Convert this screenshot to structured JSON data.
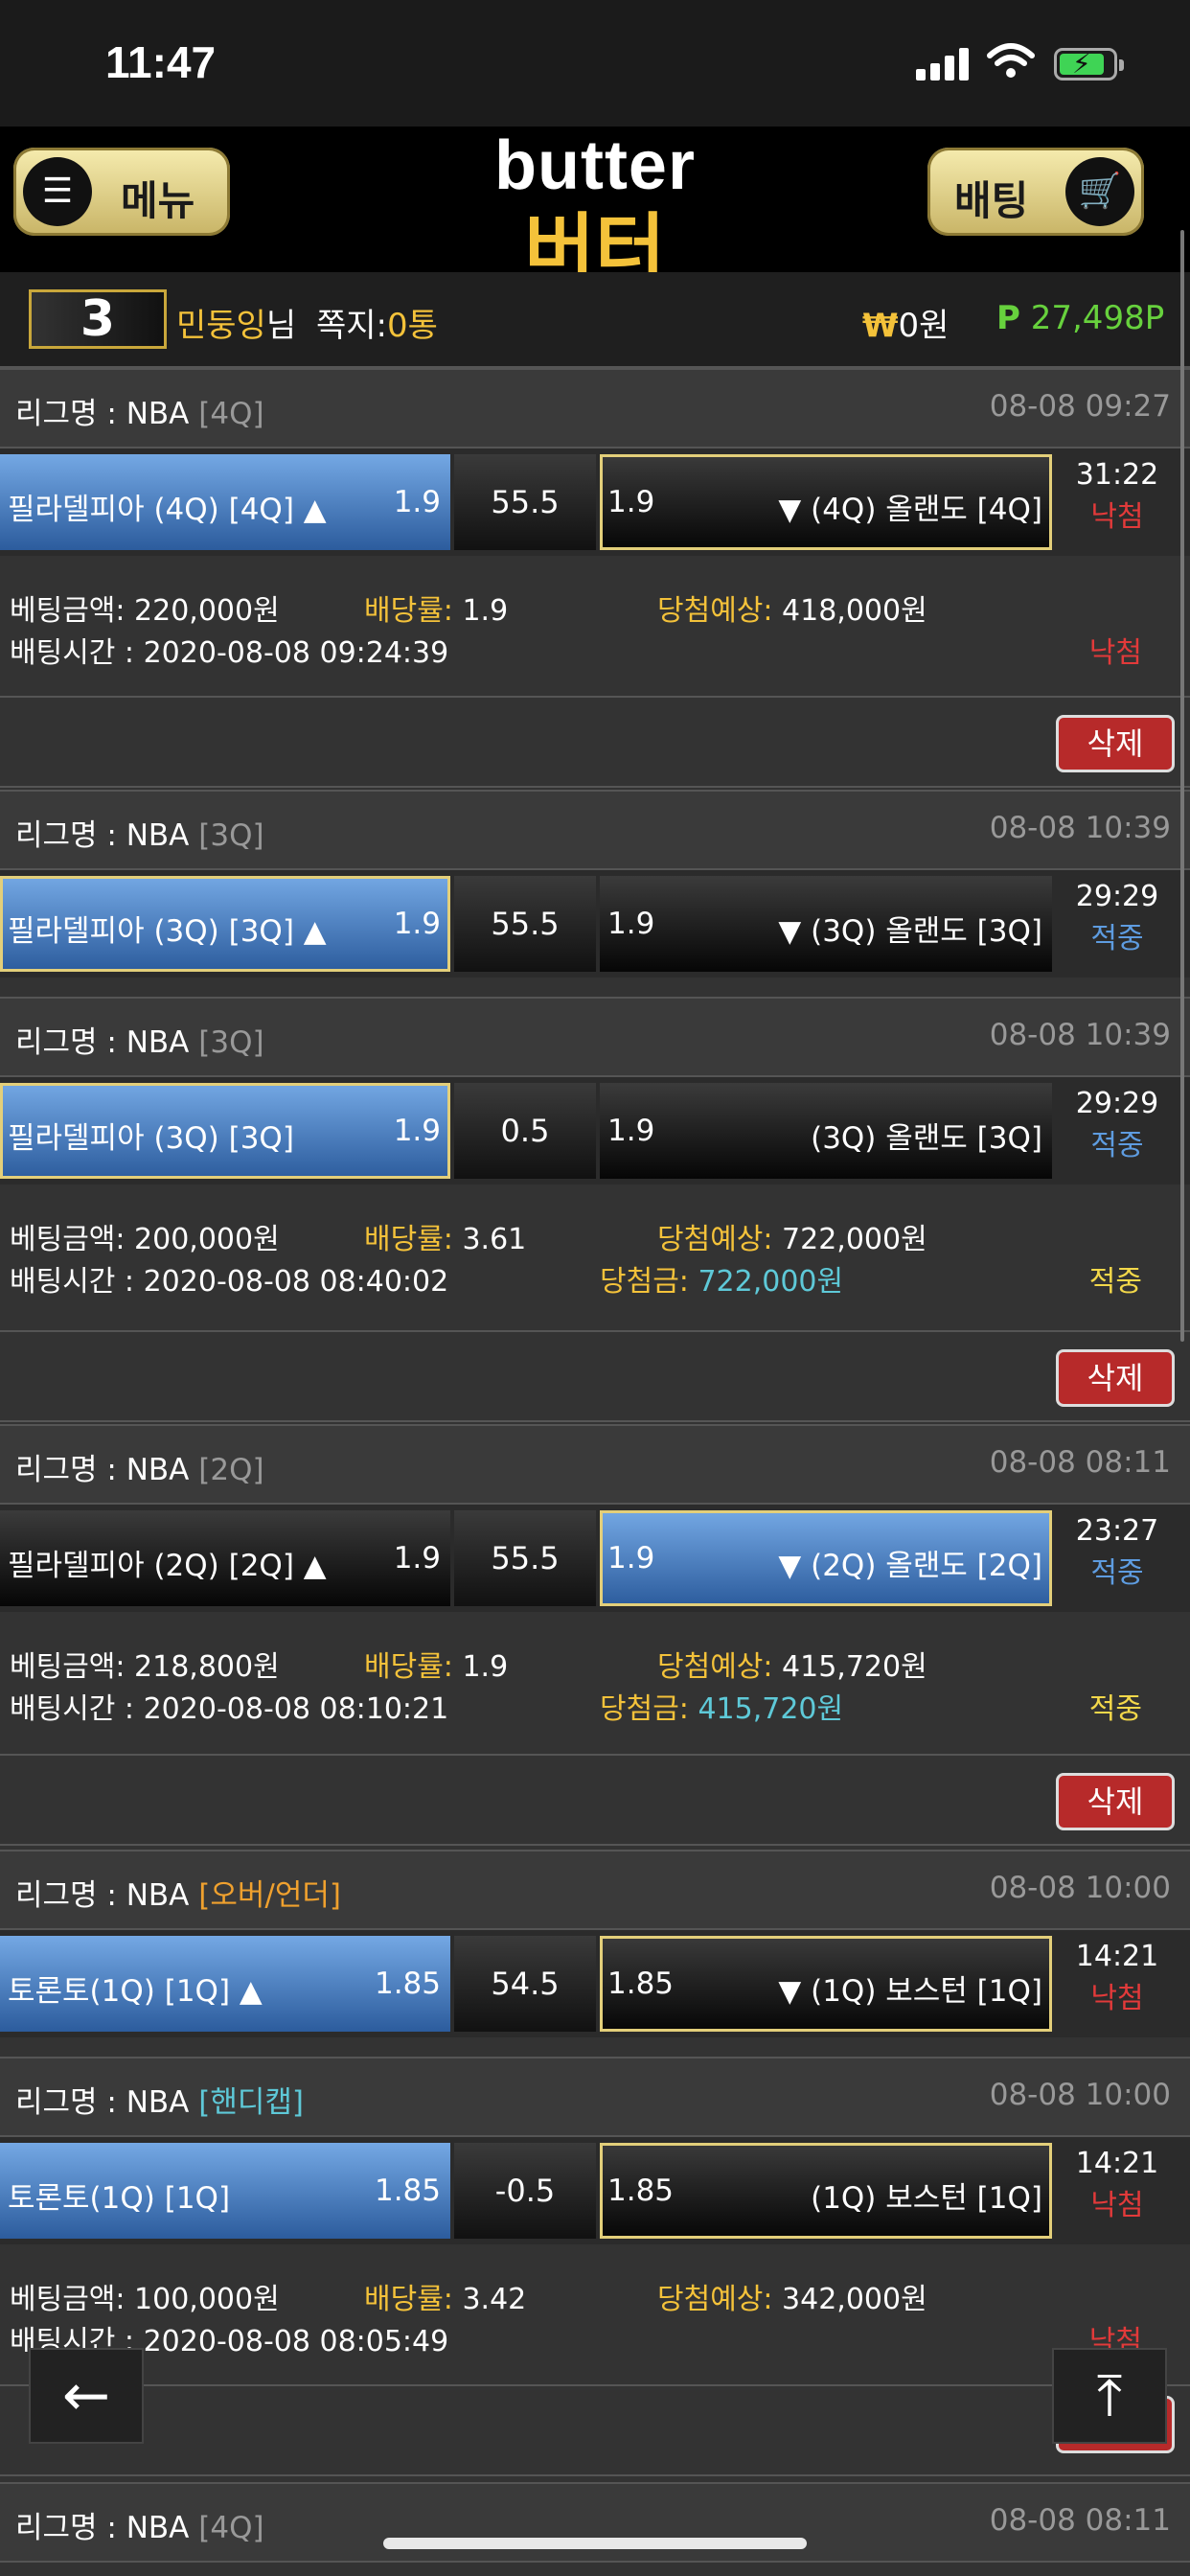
{
  "status_bar": {
    "time": "11:47"
  },
  "header": {
    "menu_label": "메뉴",
    "bet_label": "배팅",
    "logo_en": "butter",
    "logo_ko": "버터"
  },
  "user": {
    "level": "3",
    "name": "민둥잉",
    "name_suffix": "님",
    "notes_label": "쪽지:",
    "notes_count": "0통",
    "won_symbol": "₩",
    "balance": "0원",
    "points_symbol": "P",
    "points": "27,498P"
  },
  "labels": {
    "league": "리그명 : ",
    "bet_amount": "베팅금액: ",
    "odds": "배당률: ",
    "expected": "당첨예상: ",
    "bet_time": "배팅시간 : ",
    "prize": "당첨금: ",
    "delete": "삭제"
  },
  "bets": [
    {
      "league": "NBA",
      "tag": "[4Q]",
      "date": "08-08 09:27",
      "home": "필라델피아 (4Q) [4Q] ▲",
      "home_odds": "1.9",
      "line": "55.5",
      "away_odds": "1.9",
      "away": "▼ (4Q) 올랜도 [4Q]",
      "clock": "31:22",
      "status": "낙첨"
    },
    {
      "league": "NBA",
      "tag": "[3Q]",
      "date": "08-08 10:39",
      "home": "필라델피아 (3Q) [3Q] ▲",
      "home_odds": "1.9",
      "line": "55.5",
      "away_odds": "1.9",
      "away": "▼ (3Q) 올랜도 [3Q]",
      "clock": "29:29",
      "status": "적중"
    },
    {
      "league": "NBA",
      "tag": "[3Q]",
      "date": "08-08 10:39",
      "home": "필라델피아 (3Q) [3Q]",
      "home_odds": "1.9",
      "line": "0.5",
      "away_odds": "1.9",
      "away": "(3Q) 올랜도 [3Q]",
      "clock": "29:29",
      "status": "적중"
    },
    {
      "league": "NBA",
      "tag": "[2Q]",
      "date": "08-08 08:11",
      "home": "필라델피아 (2Q) [2Q] ▲",
      "home_odds": "1.9",
      "line": "55.5",
      "away_odds": "1.9",
      "away": "▼ (2Q) 올랜도 [2Q]",
      "clock": "23:27",
      "status": "적중"
    },
    {
      "league": "NBA",
      "tag": "[오버/언더]",
      "date": "08-08 10:00",
      "home": "토론토(1Q) [1Q] ▲",
      "home_odds": "1.85",
      "line": "54.5",
      "away_odds": "1.85",
      "away": "▼ (1Q) 보스턴 [1Q]",
      "clock": "14:21",
      "status": "낙첨"
    },
    {
      "league": "NBA",
      "tag": "[핸디캡]",
      "date": "08-08 10:00",
      "home": "토론토(1Q) [1Q]",
      "home_odds": "1.85",
      "line": "-0.5",
      "away_odds": "1.85",
      "away": "(1Q) 보스턴 [1Q]",
      "clock": "14:21",
      "status": "낙첨"
    },
    {
      "league": "NBA",
      "tag": "[4Q]",
      "date": "08-08 08:11"
    }
  ],
  "slips": [
    {
      "amount": "220,000원",
      "odds": "1.9",
      "expected": "418,000원",
      "time": "2020-08-08 09:24:39",
      "result": "낙첨"
    },
    {
      "amount": "200,000원",
      "odds": "3.61",
      "expected": "722,000원",
      "time": "2020-08-08 08:40:02",
      "prize": "722,000원",
      "result": "적중"
    },
    {
      "amount": "218,800원",
      "odds": "1.9",
      "expected": "415,720원",
      "time": "2020-08-08 08:10:21",
      "prize": "415,720원",
      "result": "적중"
    },
    {
      "amount": "100,000원",
      "odds": "3.42",
      "expected": "342,000원",
      "time": "2020-08-08 08:05:49",
      "result": "낙첨"
    }
  ],
  "floating": {
    "back_icon": "←",
    "top_icon": "⤒"
  }
}
